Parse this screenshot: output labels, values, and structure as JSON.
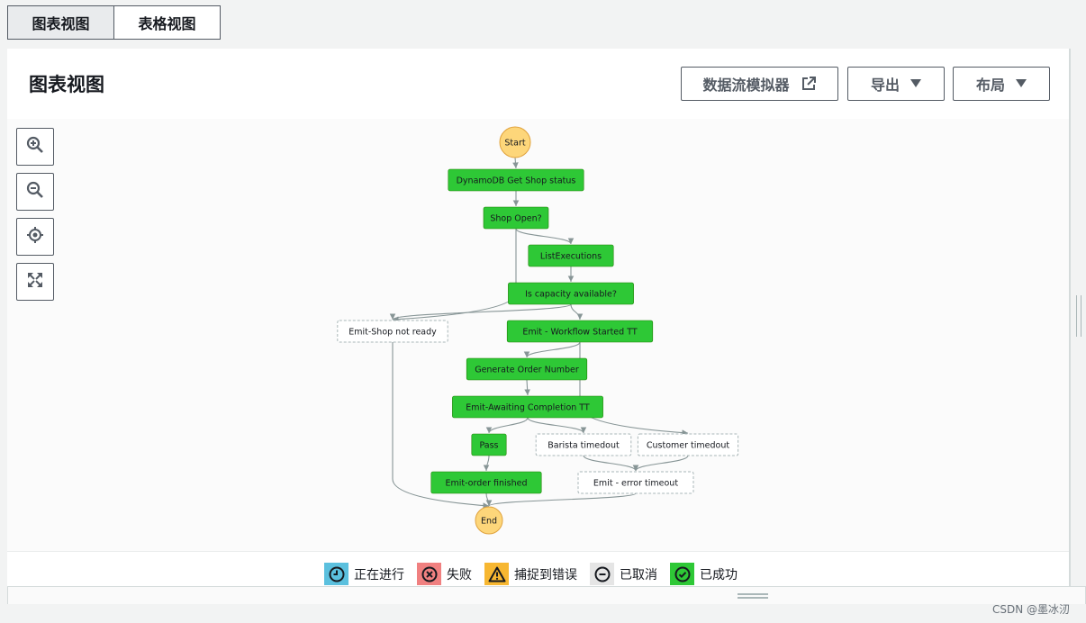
{
  "tabs": [
    {
      "label": "图表视图",
      "active": true
    },
    {
      "label": "表格视图",
      "active": false
    }
  ],
  "panel": {
    "title": "图表视图",
    "buttons": {
      "simulator": "数据流模拟器",
      "export": "导出",
      "layout": "布局"
    }
  },
  "zoom_controls": [
    "zoom-in-icon",
    "zoom-out-icon",
    "center-icon",
    "fit-screen-icon"
  ],
  "graph": {
    "nodes": [
      {
        "id": "start",
        "label": "Start",
        "kind": "terminal"
      },
      {
        "id": "getShop",
        "label": "DynamoDB Get Shop status",
        "kind": "success"
      },
      {
        "id": "shopOpen",
        "label": "Shop Open?",
        "kind": "success"
      },
      {
        "id": "listExec",
        "label": "ListExecutions",
        "kind": "success"
      },
      {
        "id": "capacity",
        "label": "Is capacity available?",
        "kind": "success"
      },
      {
        "id": "notReady",
        "label": "Emit-Shop not ready",
        "kind": "notrun"
      },
      {
        "id": "wfStarted",
        "label": "Emit - Workflow Started TT",
        "kind": "success"
      },
      {
        "id": "genOrder",
        "label": "Generate Order Number",
        "kind": "success"
      },
      {
        "id": "awaiting",
        "label": "Emit-Awaiting Completion TT",
        "kind": "success"
      },
      {
        "id": "pass",
        "label": "Pass",
        "kind": "success"
      },
      {
        "id": "barista",
        "label": "Barista timedout",
        "kind": "notrun"
      },
      {
        "id": "customer",
        "label": "Customer timedout",
        "kind": "notrun"
      },
      {
        "id": "finished",
        "label": "Emit-order finished",
        "kind": "success"
      },
      {
        "id": "errTimeout",
        "label": "Emit - error timeout",
        "kind": "notrun"
      },
      {
        "id": "end",
        "label": "End",
        "kind": "terminal"
      }
    ],
    "edges": [
      [
        "start",
        "getShop"
      ],
      [
        "getShop",
        "shopOpen"
      ],
      [
        "shopOpen",
        "notReady"
      ],
      [
        "shopOpen",
        "listExec"
      ],
      [
        "listExec",
        "capacity"
      ],
      [
        "capacity",
        "notReady"
      ],
      [
        "capacity",
        "wfStarted"
      ],
      [
        "wfStarted",
        "genOrder"
      ],
      [
        "wfStarted",
        "customer"
      ],
      [
        "genOrder",
        "awaiting"
      ],
      [
        "awaiting",
        "pass"
      ],
      [
        "awaiting",
        "barista"
      ],
      [
        "pass",
        "finished"
      ],
      [
        "barista",
        "errTimeout"
      ],
      [
        "customer",
        "errTimeout"
      ],
      [
        "finished",
        "end"
      ],
      [
        "notReady",
        "end"
      ],
      [
        "errTimeout",
        "end"
      ]
    ]
  },
  "legend": [
    {
      "label": "正在进行",
      "icon": "clock-icon",
      "bg": "#5bc0de"
    },
    {
      "label": "失败",
      "icon": "x-circle-icon",
      "bg": "#f08080"
    },
    {
      "label": "捕捉到错误",
      "icon": "warning-icon",
      "bg": "#f7b731"
    },
    {
      "label": "已取消",
      "icon": "minus-circle-icon",
      "bg": "#e5e5e5"
    },
    {
      "label": "已成功",
      "icon": "check-circle-icon",
      "bg": "#2ec836"
    }
  ],
  "colors": {
    "success": "#2ec836",
    "success_border": "#1d8102",
    "terminal": "#fdd67a",
    "terminal_border": "#e0a23c",
    "notrun_border": "#aab7b8",
    "edge": "#879596"
  },
  "watermark": "CSDN @墨冰㲽"
}
